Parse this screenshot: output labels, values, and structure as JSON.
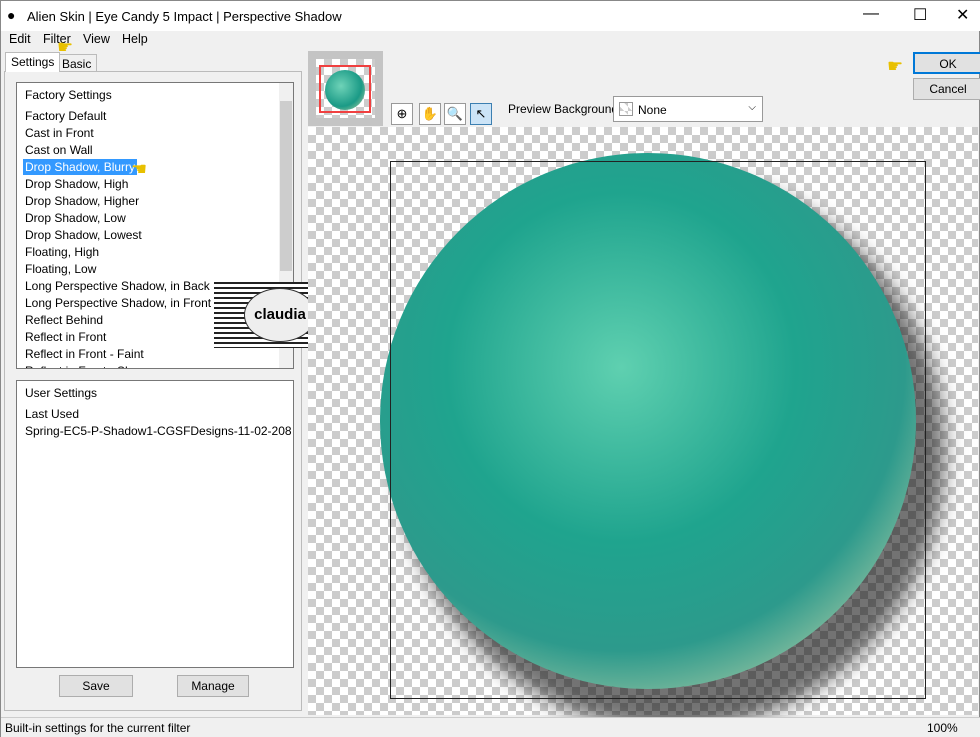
{
  "window": {
    "title": "Alien Skin | Eye Candy 5 Impact | Perspective Shadow",
    "minimize": "—",
    "maximize": "☐",
    "close": "✕"
  },
  "menu": [
    "Edit",
    "Filter",
    "View",
    "Help"
  ],
  "tabs": [
    "Settings",
    "Basic"
  ],
  "factory": {
    "header": "Factory Settings",
    "items": [
      "Factory Default",
      "Cast in Front",
      "Cast on Wall",
      "Drop Shadow, Blurry",
      "Drop Shadow, High",
      "Drop Shadow, Higher",
      "Drop Shadow, Low",
      "Drop Shadow, Lowest",
      "Floating, High",
      "Floating, Low",
      "Long Perspective Shadow, in Back",
      "Long Perspective Shadow, in Front",
      "Reflect Behind",
      "Reflect in Front",
      "Reflect in Front - Faint",
      "Reflect in Front - Sharp"
    ],
    "selected": "Drop Shadow, Blurry"
  },
  "user": {
    "header": "User Settings",
    "items": [
      "Last Used",
      "Spring-EC5-P-Shadow1-CGSFDesigns-11-02-208"
    ]
  },
  "buttons": {
    "save": "Save",
    "manage": "Manage",
    "ok": "OK",
    "cancel": "Cancel"
  },
  "preview": {
    "background_label": "Preview Background:",
    "background_value": "None",
    "tools": [
      "navigate-icon",
      "hand-icon",
      "zoom-icon",
      "pointer-icon"
    ]
  },
  "watermark": "claudia",
  "status": {
    "text": "Built-in settings for the current filter",
    "zoom": "100%"
  }
}
